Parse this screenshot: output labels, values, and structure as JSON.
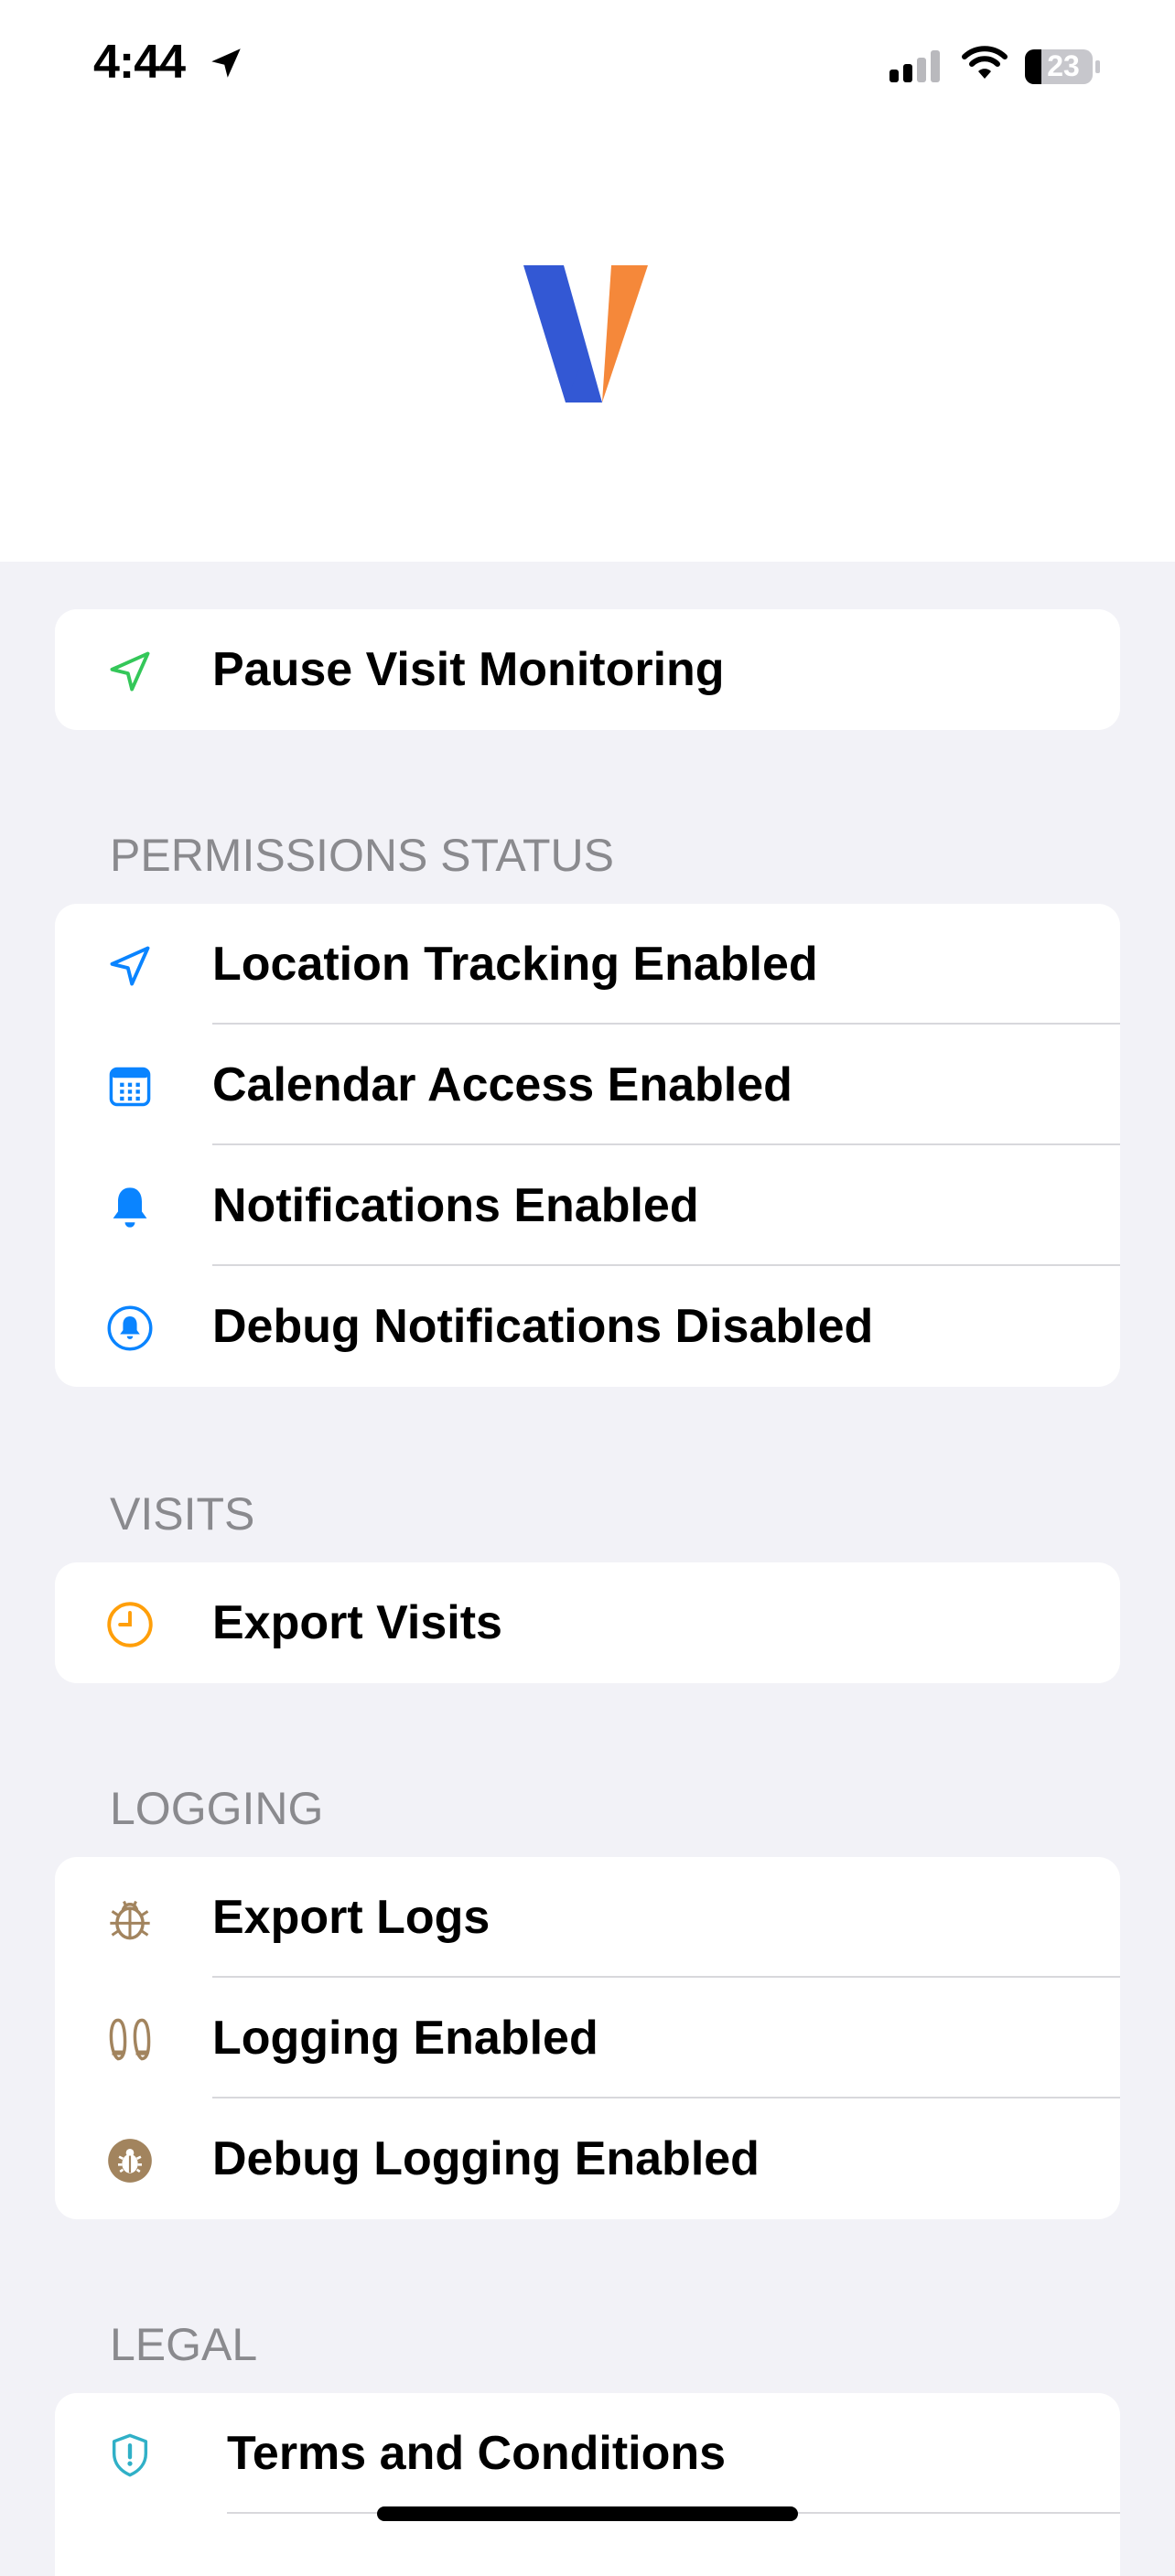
{
  "status_bar": {
    "time": "4:44",
    "battery_level": "23",
    "icons": [
      "location-arrow-icon",
      "cellular-signal-icon",
      "wifi-icon",
      "battery-icon"
    ]
  },
  "logo": {
    "letter": "V",
    "colors": {
      "left": "#3358d4",
      "right": "#f5883a"
    }
  },
  "monitoring": {
    "label": "Pause Visit Monitoring",
    "icon": "location-arrow-icon",
    "icon_color": "#34c759"
  },
  "permissions": {
    "header": "PERMISSIONS STATUS",
    "items": [
      {
        "label": "Location Tracking Enabled",
        "icon": "location-arrow-icon",
        "icon_color": "#0a84ff"
      },
      {
        "label": "Calendar Access Enabled",
        "icon": "calendar-icon",
        "icon_color": "#0a84ff"
      },
      {
        "label": "Notifications Enabled",
        "icon": "bell-icon",
        "icon_color": "#0a84ff"
      },
      {
        "label": "Debug Notifications Disabled",
        "icon": "bell-circle-icon",
        "icon_color": "#0a84ff"
      }
    ]
  },
  "visits": {
    "header": "VISITS",
    "items": [
      {
        "label": "Export Visits",
        "icon": "clock-icon",
        "icon_color": "#ff9f0a"
      }
    ]
  },
  "logging": {
    "header": "LOGGING",
    "items": [
      {
        "label": "Export Logs",
        "icon": "ladybug-icon",
        "icon_color": "#a2845e"
      },
      {
        "label": "Logging Enabled",
        "icon": "shoeprints-icon",
        "icon_color": "#a2845e"
      },
      {
        "label": "Debug Logging Enabled",
        "icon": "ladybug-circle-icon",
        "icon_color": "#a2845e"
      }
    ]
  },
  "legal": {
    "header": "LEGAL",
    "items": [
      {
        "label": "Terms and Conditions",
        "icon": "shield-exclamation-icon",
        "icon_color": "#30b0c7"
      }
    ]
  }
}
